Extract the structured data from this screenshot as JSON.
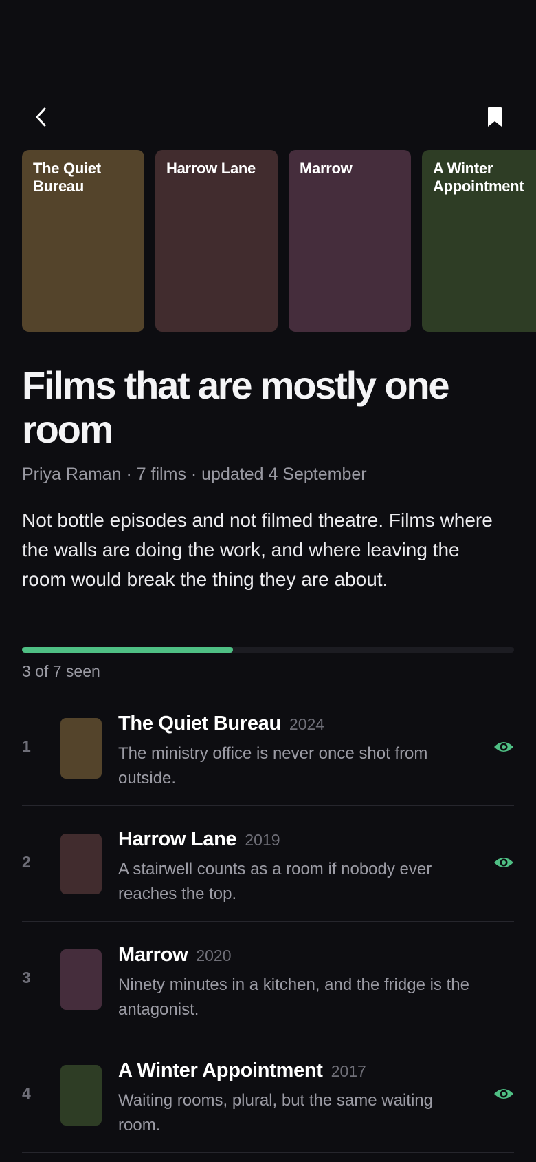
{
  "header": {
    "back_icon": "chevron-left-icon",
    "bookmark_icon": "bookmark-icon"
  },
  "posters": [
    {
      "title": "The Quiet Bureau",
      "color": "#54442b"
    },
    {
      "title": "Harrow Lane",
      "color": "#412c2e"
    },
    {
      "title": "Marrow",
      "color": "#452d3c"
    },
    {
      "title": "A Winter Appointment",
      "color": "#2e3d25"
    }
  ],
  "list": {
    "title": "Films that are mostly one room",
    "meta": "Priya Raman · 7 films · updated 4 September",
    "description": "Not bottle episodes and not filmed theatre. Films where the walls are doing the work, and where leaving the room would break the thing they are about.",
    "progress_fraction": 0.4286,
    "progress_label": "3 of 7 seen",
    "accent_color": "#4fbf84"
  },
  "films": [
    {
      "rank": "1",
      "title": "The Quiet Bureau",
      "year": "2024",
      "note": "The ministry office is never once shot from outside.",
      "seen": true,
      "color": "#54442b"
    },
    {
      "rank": "2",
      "title": "Harrow Lane",
      "year": "2019",
      "note": "A stairwell counts as a room if nobody ever reaches the top.",
      "seen": true,
      "color": "#412c2e"
    },
    {
      "rank": "3",
      "title": "Marrow",
      "year": "2020",
      "note": "Ninety minutes in a kitchen, and the fridge is the antagonist.",
      "seen": false,
      "color": "#452d3c"
    },
    {
      "rank": "4",
      "title": "A Winter Appointment",
      "year": "2017",
      "note": "Waiting rooms, plural, but the same waiting room.",
      "seen": true,
      "color": "#2e3d25"
    }
  ]
}
